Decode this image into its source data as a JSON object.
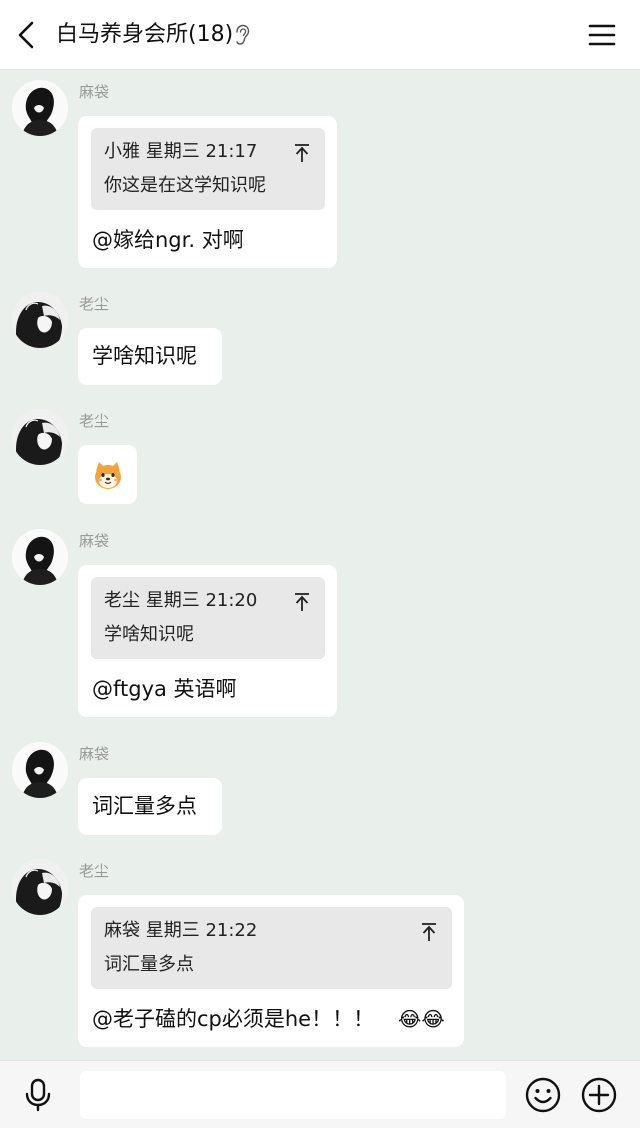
{
  "header": {
    "title": "白马养身会所(18)",
    "back_icon": "chevron-left-icon",
    "ear_icon": "ear-icon",
    "menu_icon": "hamburger-menu-icon"
  },
  "messages": [
    {
      "sender": "麻袋",
      "quote": {
        "meta": "小雅 星期三 21:17",
        "text": "你这是在这学知识呢"
      },
      "text": "@嫁给ngr. 对啊"
    },
    {
      "sender": "老尘",
      "text": "学啥知识呢"
    },
    {
      "sender": "老尘",
      "sticker": "shiba-dog-sticker"
    },
    {
      "sender": "麻袋",
      "quote": {
        "meta": "老尘 星期三 21:20",
        "text": "学啥知识呢"
      },
      "text": "@ftgya 英语啊"
    },
    {
      "sender": "麻袋",
      "text": "词汇量多点"
    },
    {
      "sender": "老尘",
      "quote": {
        "meta": "麻袋 星期三 21:22",
        "text": "词汇量多点"
      },
      "text": "@老子磕的cp必须是he！！！",
      "emojis": "😂😂"
    }
  ],
  "inputbar": {
    "placeholder": "",
    "mic_icon": "microphone-icon",
    "emoji_icon": "smiley-icon",
    "plus_icon": "plus-circle-icon"
  },
  "colors": {
    "chat_background": "#e9efea",
    "bubble": "#ffffff",
    "quote_background": "#e8e8e8",
    "sender_name": "#9a9a9a"
  }
}
